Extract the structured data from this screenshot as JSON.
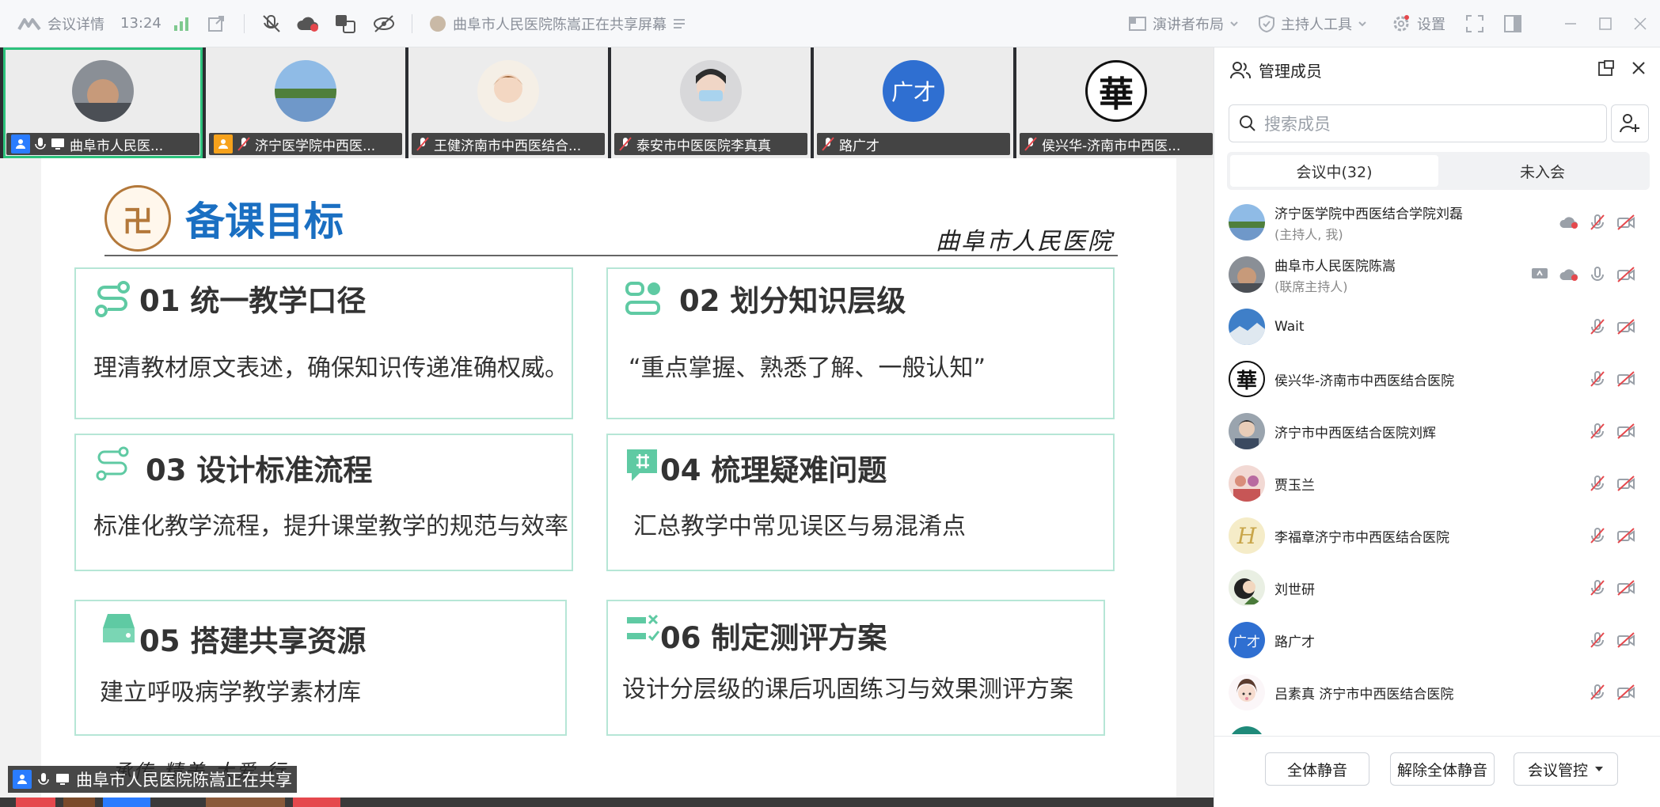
{
  "topbar": {
    "meeting_details": "会议详情",
    "time": "13:24",
    "sharing_status": "曲阜市人民医院陈嵩正在共享屏幕",
    "layout": "演讲者布局",
    "host_tools": "主持人工具",
    "settings": "设置"
  },
  "strip": {
    "tiles": [
      {
        "name": "曲阜市人民医..."
      },
      {
        "name": "济宁医学院中西医..."
      },
      {
        "name": "王健济南市中西医结合..."
      },
      {
        "name": "泰安市中医医院李真真"
      },
      {
        "name": "路广才",
        "avatar_text": "广才"
      },
      {
        "name": "侯兴华-济南市中西医...",
        "avatar_text": "華"
      }
    ]
  },
  "slide": {
    "title": "备课目标",
    "logo_text": "卍",
    "brand": "曲阜市人民医院",
    "footer": "承传 精美  大爱 行",
    "cards": [
      {
        "title": "01 统一教学口径",
        "body": "理清教材原文表述，确保知识传递准确权威。"
      },
      {
        "title": "02 划分知识层级",
        "body": "“重点掌握、熟悉了解、一般认知”"
      },
      {
        "title": "03 设计标准流程",
        "body": "标准化教学流程，提升课堂教学的规范与效率"
      },
      {
        "title": "04 梳理疑难问题",
        "body": "汇总教学中常见误区与易混淆点"
      },
      {
        "title": "05 搭建共享资源",
        "body": "建立呼吸病学教学素材库"
      },
      {
        "title": "06 制定测评方案",
        "body": "设计分层级的课后巩固练习与效果测评方案"
      }
    ]
  },
  "share_label": "曲阜市人民医院陈嵩正在共享",
  "panel": {
    "title": "管理成员",
    "search_placeholder": "搜索成员",
    "tab_in": "会议中(32)",
    "tab_out": "未入会",
    "members": [
      {
        "name": "济宁医学院中西医结合学院刘磊",
        "role": "(主持人, 我)"
      },
      {
        "name": "曲阜市人民医院陈嵩",
        "role": "(联席主持人)"
      },
      {
        "name": "Wait",
        "role": ""
      },
      {
        "name": "侯兴华-济南市中西医结合医院",
        "role": "",
        "avatar_text": "華"
      },
      {
        "name": "济宁市中西医结合医院刘辉",
        "role": ""
      },
      {
        "name": "贾玉兰",
        "role": ""
      },
      {
        "name": "李福章济宁市中西医结合医院",
        "role": "",
        "avatar_text": "H"
      },
      {
        "name": "刘世研",
        "role": ""
      },
      {
        "name": "路广才",
        "role": "",
        "avatar_text": "广才"
      },
      {
        "name": "吕素真 济宁市中西医结合医院",
        "role": ""
      }
    ],
    "mute_all": "全体静音",
    "unmute_all": "解除全体静音",
    "meeting_control": "会议管控"
  },
  "colors": {
    "accent_blue": "#2a7cff",
    "active_green": "#2cc27c",
    "card_border": "#b6e6d6",
    "slide_title": "#1a6fc2",
    "muted_red": "#e5484d"
  }
}
